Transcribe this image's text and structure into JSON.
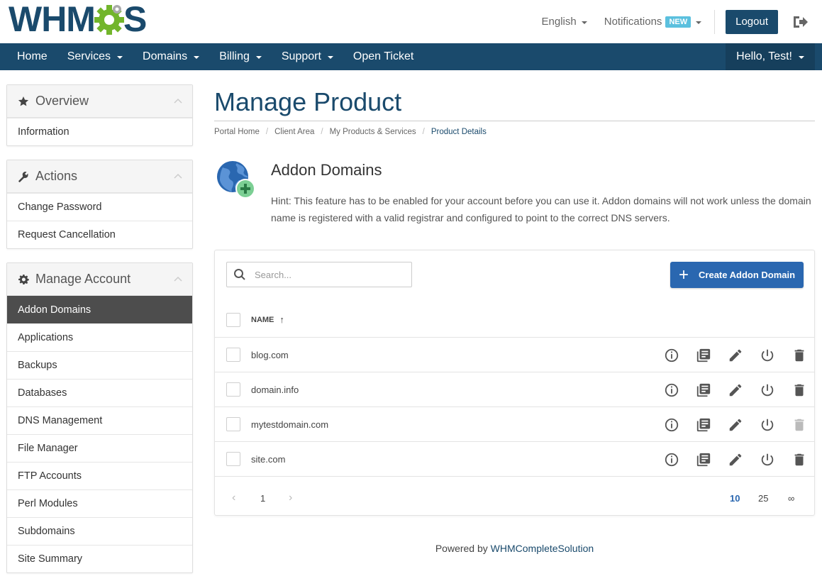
{
  "header": {
    "logo_text_left": "WHM",
    "logo_text_right": "S",
    "language": "English",
    "notifications": "Notifications",
    "notifications_badge": "NEW",
    "logout": "Logout"
  },
  "nav": {
    "items": [
      {
        "label": "Home",
        "dropdown": false
      },
      {
        "label": "Services",
        "dropdown": true
      },
      {
        "label": "Domains",
        "dropdown": true
      },
      {
        "label": "Billing",
        "dropdown": true
      },
      {
        "label": "Support",
        "dropdown": true
      },
      {
        "label": "Open Ticket",
        "dropdown": false
      }
    ],
    "user": "Hello, Test!"
  },
  "sidebar": {
    "overview": {
      "title": "Overview",
      "items": [
        "Information"
      ]
    },
    "actions": {
      "title": "Actions",
      "items": [
        "Change Password",
        "Request Cancellation"
      ]
    },
    "manage": {
      "title": "Manage Account",
      "items": [
        "Addon Domains",
        "Applications",
        "Backups",
        "Databases",
        "DNS Management",
        "File Manager",
        "FTP Accounts",
        "Perl Modules",
        "Subdomains",
        "Site Summary"
      ],
      "active": "Addon Domains"
    }
  },
  "main": {
    "title": "Manage Product",
    "breadcrumb": [
      "Portal Home",
      "Client Area",
      "My Products & Services",
      "Product Details"
    ],
    "feature_title": "Addon Domains",
    "hint": "Hint: This feature has to be enabled for your account before you can use it. Addon domains will not work unless the domain name is registered with a valid registrar and configured to point to the correct DNS servers.",
    "search_placeholder": "Search...",
    "create_button": "Create Addon Domain",
    "column_name": "NAME",
    "sort_arrow": "↑",
    "rows": [
      {
        "domain": "blog.com",
        "delete_enabled": true
      },
      {
        "domain": "domain.info",
        "delete_enabled": true
      },
      {
        "domain": "mytestdomain.com",
        "delete_enabled": false
      },
      {
        "domain": "site.com",
        "delete_enabled": true
      }
    ],
    "pagination": {
      "prev": "‹",
      "page": "1",
      "next": "›",
      "sizes": [
        "10",
        "25",
        "∞"
      ],
      "active_size": "10"
    }
  },
  "footer": {
    "prefix": "Powered by",
    "link": "WHMCompleteSolution"
  },
  "colors": {
    "brand": "#1a4a6c",
    "accent": "#2a67b0",
    "badge": "#5bc0de",
    "active_item": "#4d4d4d"
  }
}
